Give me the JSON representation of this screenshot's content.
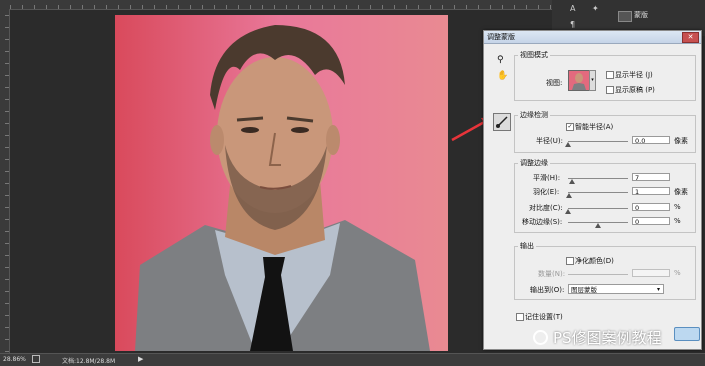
{
  "status": {
    "zoom": "28.86%",
    "doc_info": "文档:12.8M/28.8M"
  },
  "top_panel": {
    "item_label": "蒙版"
  },
  "dialog": {
    "title": "调整蒙版",
    "view_mode": {
      "group_title": "视图模式",
      "view_label": "视图:",
      "show_radius": "显示半径 (J)",
      "show_original": "显示原稿 (P)"
    },
    "edge_detection": {
      "group_title": "边缘检测",
      "smart_radius": "智能半径(A)",
      "smart_radius_checked": true,
      "radius_label": "半径(U):",
      "radius_value": "0.0",
      "radius_unit": "像素",
      "radius_level": 0
    },
    "adjust_edge": {
      "group_title": "调整边缘",
      "rows": [
        {
          "label": "平滑(H):",
          "value": "7",
          "unit": "",
          "level": 0.07
        },
        {
          "label": "羽化(E):",
          "value": "1",
          "unit": "像素",
          "level": 0.02
        },
        {
          "label": "对比度(C):",
          "value": "0",
          "unit": "%",
          "level": 0
        },
        {
          "label": "移动边缘(S):",
          "value": "0",
          "unit": "%",
          "level": 0.5
        }
      ]
    },
    "output": {
      "group_title": "输出",
      "decontaminate": "净化颜色(D)",
      "amount_label": "数量(N):",
      "amount_unit": "%",
      "output_to_label": "输出到(O):",
      "output_to_value": "图层蒙版"
    },
    "remember": "记住设置(T)"
  },
  "watermark": "PS修图案例教程",
  "colors": {
    "arrow": "#e8343a",
    "canvas_bg": "#e36a7e",
    "dialog_bg": "#eeeeee"
  }
}
